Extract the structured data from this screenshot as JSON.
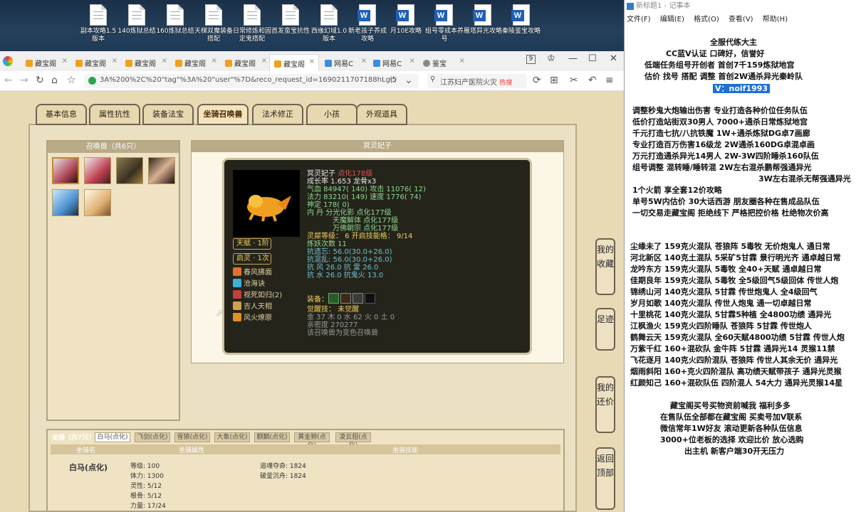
{
  "desktop": {
    "icons": [
      {
        "label": "副本攻略1.5版本",
        "type": "txt"
      },
      {
        "label": "140炼狱总结",
        "type": "txt"
      },
      {
        "label": "160炼狱总结",
        "type": "txt"
      },
      {
        "label": "天梯双魔装备搭配",
        "type": "txt"
      },
      {
        "label": "日常修炼和固定鬼搭配",
        "type": "txt"
      },
      {
        "label": "首发蛮宝抗性",
        "type": "txt"
      },
      {
        "label": "西缘幻域1.0版本",
        "type": "txt"
      },
      {
        "label": "新老孩子养成攻略",
        "type": "word"
      },
      {
        "label": "月10E攻略",
        "type": "word"
      },
      {
        "label": "组号零成本养号",
        "type": "word"
      },
      {
        "label": "雁塔异光攻略",
        "type": "word"
      },
      {
        "label": "秦陵鉴宝攻略",
        "type": "word"
      }
    ]
  },
  "browser": {
    "tabs": [
      {
        "label": "藏宝阁"
      },
      {
        "label": "藏宝阁"
      },
      {
        "label": "藏宝阁"
      },
      {
        "label": "藏宝阁"
      },
      {
        "label": "藏宝阁"
      },
      {
        "label": "藏宝阁"
      },
      {
        "label": "网易C"
      },
      {
        "label": "网易C"
      },
      {
        "label": "鉴宝"
      }
    ],
    "tab_count": "9",
    "url": "3A%200%2C%20\"tag\"%3A%20\"user\"%7D&reco_request_id=1690211707188hLgl5",
    "search_text": "江苏妇产医院火灾",
    "search_hot": "热搜"
  },
  "game": {
    "tabs": [
      "基本信息",
      "属性抗性",
      "装备法宝",
      "坐骑召唤兽",
      "法术修正",
      "小孩",
      "外观道具"
    ],
    "active_tab": "坐骑召唤兽",
    "summon_panel_title": "召唤兽（共6只）",
    "detail_title": "冥灵妃子",
    "pet": {
      "name": "冥灵妃子",
      "name_tag": "点化178级",
      "growth": "成长率 1.653 龙骨x3",
      "hp": "气血 84947( 140) 攻击 11076( 12)",
      "mp": "法力 83210( 149) 速度 1776( 74)",
      "spirit": "神定 178( 0)",
      "dan1": "内   丹 分光化影 点化177级",
      "dan2": "天魔解体 点化177级",
      "dan3": "万佛朝宗 点化177级",
      "spirit_level": "灵犀等级： 6 开启技能格： 9/14",
      "yao": "炼妖次数 11",
      "res1": "抗遗忘: 56.0(30.0+26.0)",
      "res2": "抗混乱: 56.0(30.0+26.0)",
      "res3": "抗   风 26.0  抗   雷 26.0",
      "res4": "抗   水 26.0  抗鬼火 13.0",
      "equip_label": "装备：",
      "awaken": "觉醒技：   未觉醒",
      "elements": "金 37  木 0  水 62  火 0  土 0",
      "intimacy": "亲密度 270277",
      "note": "该召唤兽为变色召唤兽",
      "talent": "天赋 · 1阶",
      "qiling": "启灵 · 1次",
      "skills": [
        "春风拂面",
        "沧海诀",
        "视死如归(2)",
        "吉人天相",
        "风火燎原"
      ]
    },
    "mount_panel": {
      "title": "坐骑（共7只）",
      "tabs": [
        "白马(点化)",
        "飞剑(点化)",
        "雪狼(点化)",
        "大象(点化)",
        "麒麟(点化)",
        "黄金狮(点化)",
        "凌云翅(点化)"
      ],
      "col_name": "坐骑名",
      "col_attr": "坐骑属性",
      "col_skill": "坐骑技能",
      "name": "白马(点化)",
      "attrs": [
        "等级: 100",
        "体力: 1300",
        "灵性: 5/12",
        "根骨: 5/12",
        "力量: 17/24"
      ],
      "skills": [
        "追魂夺命: 1824",
        "破釜沉舟: 1824"
      ]
    },
    "side_buttons": [
      {
        "label": "我的收藏"
      },
      {
        "label": "足迹"
      },
      {
        "label": "我的还价"
      },
      {
        "label": "返回顶部"
      }
    ]
  },
  "notepad": {
    "title": "新标题1 - 记事本",
    "menu": [
      "文件(F)",
      "编辑(E)",
      "格式(O)",
      "查看(V)",
      "帮助(H)"
    ],
    "lines": [
      "全服代练大主",
      "CC蓝V认证  口碑好，信誉好",
      "低端任务组号开创者          首创7千159炼狱地宫",
      "估价 找号 搭配 调整          首创2W通杀异光秦岭队",
      "V：noif1993",
      "调整秒鬼大炮输出伤害        专业打造各种价位任务队伍",
      "低价打造站街双30男人            7000+通杀日常炼狱地宫",
      "千元打造七抗/八抗铁魔          1W+通杀炼狱DG卓7画廊",
      "专业打造百万伤害16级龙         2W通杀160DG卓混卓画",
      "万元打造通杀异光14男人        2W-3W四阶睡杀160队伍",
      "组号调整 混转睡/睡转混          2W左右混杀鹏帮强通异光",
      "3W左右混杀无帮强通异光",
      "1个火箭 享全套12价攻略",
      "单号5W内估价 30大话西游         朋友圈各种在售成品队伍",
      "一切交易走藏宝阁 拒绝线下      严格把控价格 杜绝物次价高",
      "尘缘未了 159克火混队 苍狼阵 5毒牧 无价炮鬼人 通日常",
      "河北新区 140克土混队 5采矿5甘霖 景行明光齐 通卓越日常",
      "龙吟东方 159克火混队 5毒牧 全40+天赋 通卓越日常",
      "佳期良年 159克火混队 5毒牧 全5级回气5级回体 传世人炮",
      "锦绣山河 140克火混队 5甘霖 传世炮鬼人 全4级回气",
      "岁月如歌 140克火混队 传世人炮鬼 通一切卓越日常",
      "十里桃花 140克火混队 5甘霖5种植 全4800功绩 通异光",
      "江枫渔火 159克火四阶睡队 苍狼阵 5甘霖 传世炮人",
      "鹤舞云天 159克火混队 全60天赋4800功绩 5甘霖 传世人炮",
      "万紫千红 160+混砍队 金牛阵 5甘霖 通异光14 灵猴11禁",
      "飞花逐月 140克火四阶混队 苍狼阵 传世人其余无价 通异光",
      "烟雨斜阳 160+克火四阶混队 高功绩天赋带孩子 通异光灵猴",
      "红颜知己 160+混砍队伍 四阶混人 54大力 通异光灵猴14星",
      "藏宝阁买号买物资前喊我 福利多多",
      "在售队伍全部都在藏宝阁 买卖号加V联系",
      "微信常年1W好友 滚动更新各种队伍信息",
      "3000+位老板的选择 欢迎比价 放心选购",
      "出主机 新客户端30开无压力"
    ]
  }
}
